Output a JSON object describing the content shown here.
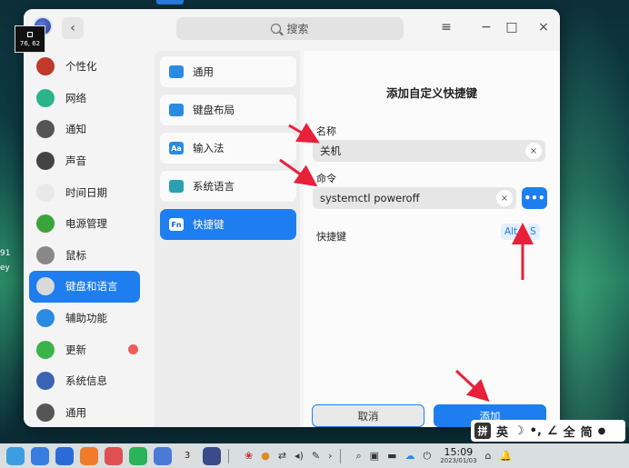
{
  "desktop": {
    "side_text_1": "91",
    "side_text_2": "ey",
    "cursor_coord": "76, 62"
  },
  "titlebar": {
    "search_placeholder": "搜索",
    "back_icon": "chevron-left-icon",
    "menu_icon": "hamburger-menu-icon",
    "minimize_icon": "minimize-icon",
    "maximize_icon": "maximize-icon",
    "close_icon": "close-icon"
  },
  "sidebar": {
    "items": [
      {
        "label": "个性化",
        "icon": "personalization-icon",
        "color": "#c0392b"
      },
      {
        "label": "网络",
        "icon": "network-icon",
        "color": "#2bb38a"
      },
      {
        "label": "通知",
        "icon": "bell-icon",
        "color": "#555555"
      },
      {
        "label": "声音",
        "icon": "speaker-icon",
        "color": "#444444"
      },
      {
        "label": "时间日期",
        "icon": "clock-icon",
        "color": "#e9e9e9"
      },
      {
        "label": "电源管理",
        "icon": "battery-icon",
        "color": "#3aa43a"
      },
      {
        "label": "鼠标",
        "icon": "mouse-icon",
        "color": "#888888"
      },
      {
        "label": "键盘和语言",
        "icon": "keyboard-icon",
        "color": "#d9d9d9",
        "active": true
      },
      {
        "label": "辅助功能",
        "icon": "accessibility-icon",
        "color": "#2a8be0"
      },
      {
        "label": "更新",
        "icon": "update-icon",
        "color": "#3ab34a",
        "badge": true
      },
      {
        "label": "系统信息",
        "icon": "system-info-icon",
        "color": "#3a63b5"
      },
      {
        "label": "通用",
        "icon": "general-icon",
        "color": "#555555"
      }
    ]
  },
  "midnav": {
    "items": [
      {
        "label": "通用",
        "icon": "gear-icon",
        "color": "#2a8be0"
      },
      {
        "label": "键盘布局",
        "icon": "keyboard-layout-icon",
        "color": "#2a8be0"
      },
      {
        "label": "输入法",
        "icon": "input-method-icon",
        "glyph": "Aa",
        "color": "#2a8be0"
      },
      {
        "label": "系统语言",
        "icon": "language-icon",
        "color": "#2aa0b0"
      },
      {
        "label": "快捷键",
        "icon": "shortcut-icon",
        "glyph": "Fn",
        "color": "#1a5fc4",
        "active": true
      }
    ]
  },
  "dialog": {
    "title": "添加自定义快捷键",
    "name_label": "名称",
    "name_value": "关机",
    "command_label": "命令",
    "command_value": "systemctl poweroff",
    "more_button": "•••",
    "shortcut_label": "快捷键",
    "shortcut_keys": [
      "Alt",
      "S"
    ],
    "cancel_label": "取消",
    "add_label": "添加"
  },
  "ime": {
    "pin": "拼",
    "lang": "英",
    "moon": "☽",
    "punct": "•,",
    "pen": "∠",
    "full": "全",
    "simp": "简",
    "mic": "🎤"
  },
  "taskbar": {
    "time": "15:09",
    "date": "2023/01/03",
    "calendar_day": "3",
    "app_colors": [
      "#3a9ee0",
      "#3a7de0",
      "#2a6bd8",
      "#f07b2a",
      "#e05050",
      "#2bb35a",
      "#4a7ad8",
      "#dddddd",
      "#3a4a8a"
    ],
    "accent": "#1e7ef0"
  }
}
